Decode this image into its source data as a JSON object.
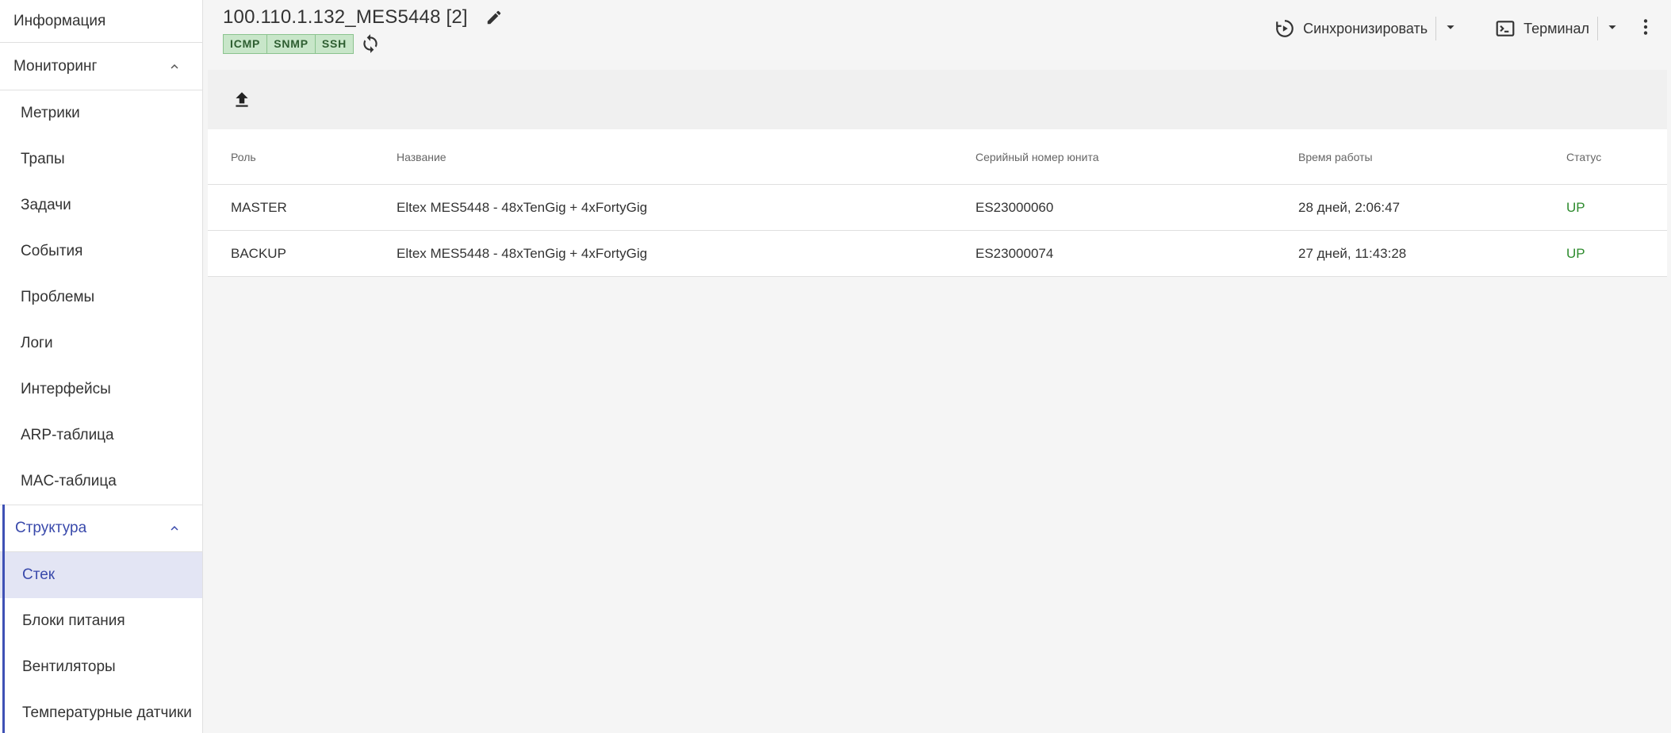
{
  "sidebar": {
    "info": "Информация",
    "monitoring": {
      "label": "Мониторинг",
      "items": [
        "Метрики",
        "Трапы",
        "Задачи",
        "События",
        "Проблемы",
        "Логи",
        "Интерфейсы",
        "ARP-таблица",
        "MAC-таблица"
      ]
    },
    "structure": {
      "label": "Структура",
      "items": [
        "Стек",
        "Блоки питания",
        "Вентиляторы",
        "Температурные датчики"
      ],
      "active": "Стек"
    }
  },
  "header": {
    "title": "100.110.1.132_MES5448 [2]",
    "protocols": [
      "ICMP",
      "SNMP",
      "SSH"
    ],
    "sync_label": "Синхронизировать",
    "terminal_label": "Терминал"
  },
  "table": {
    "columns": [
      "Роль",
      "Название",
      "Серийный номер юнита",
      "Время работы",
      "Статус"
    ],
    "rows": [
      {
        "role": "MASTER",
        "name": "Eltex MES5448 - 48xTenGig + 4xFortyGig",
        "serial": "ES23000060",
        "uptime": "28 дней, 2:06:47",
        "status": "UP"
      },
      {
        "role": "BACKUP",
        "name": "Eltex MES5448 - 48xTenGig + 4xFortyGig",
        "serial": "ES23000074",
        "uptime": "27 дней, 11:43:28",
        "status": "UP"
      }
    ]
  },
  "colors": {
    "accent": "#3949ab",
    "status_up": "#2e8b2e",
    "protocol_badge": "#c8e6c9"
  }
}
